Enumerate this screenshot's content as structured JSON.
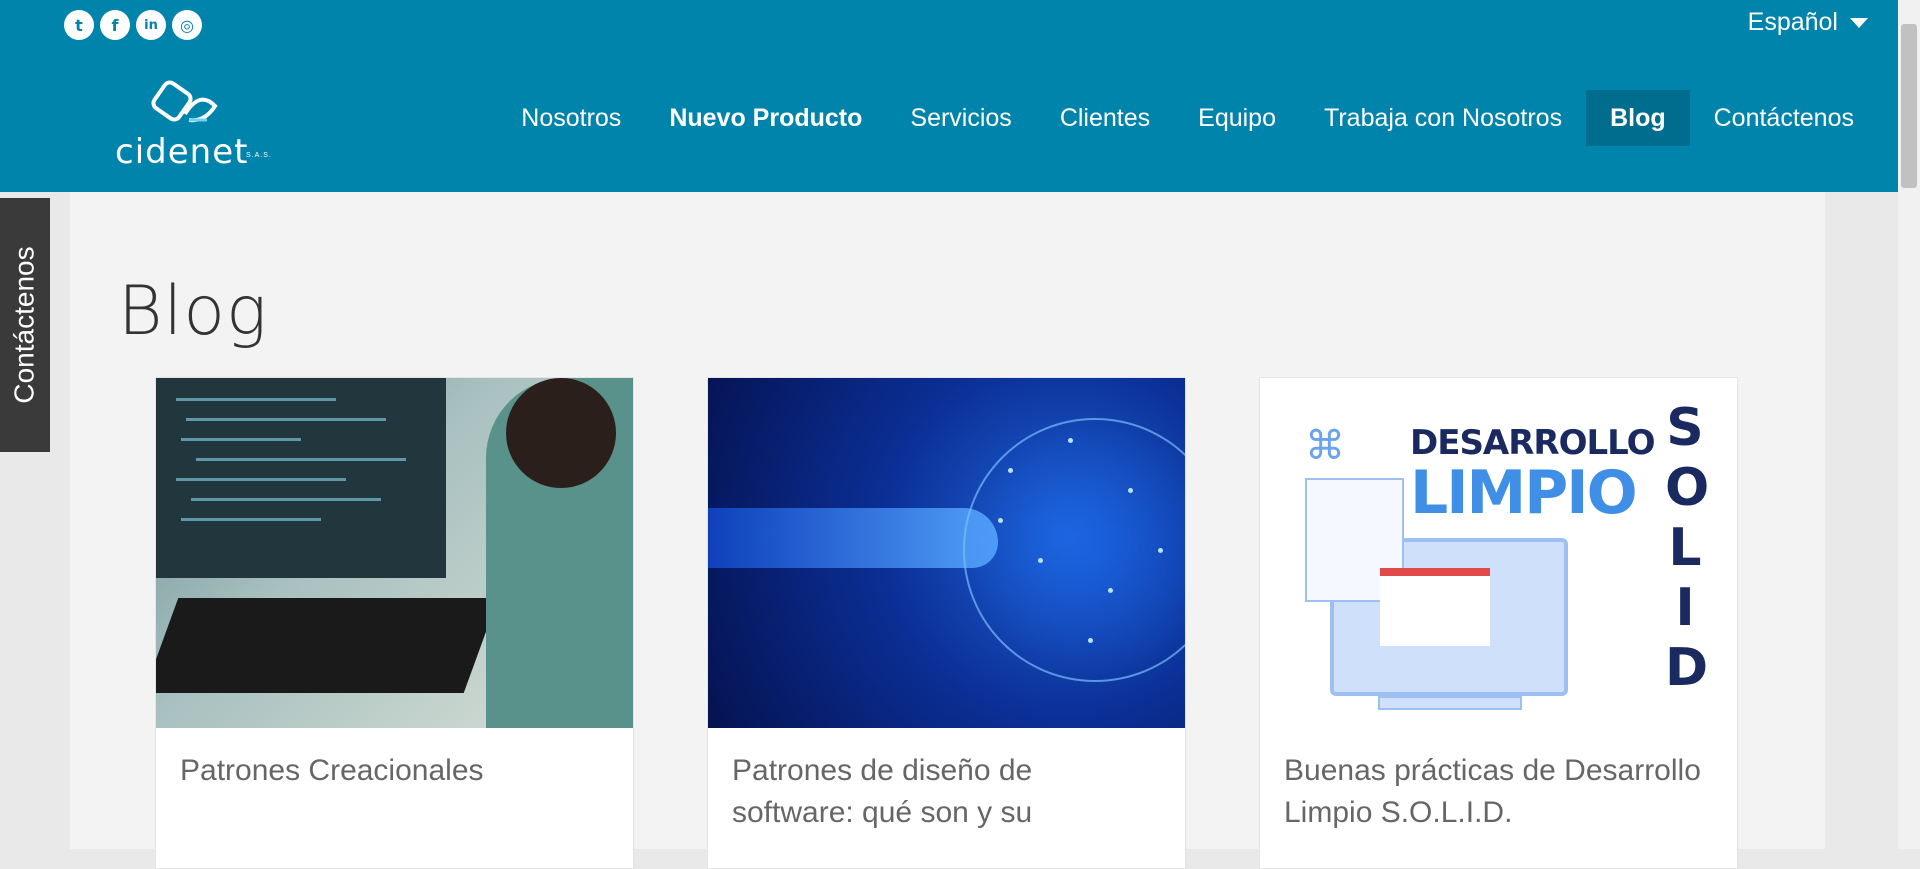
{
  "header": {
    "social": [
      {
        "name": "twitter-icon",
        "glyph": "t"
      },
      {
        "name": "facebook-icon",
        "glyph": "f"
      },
      {
        "name": "linkedin-icon",
        "glyph": "in"
      },
      {
        "name": "instagram-icon",
        "glyph": "◎"
      }
    ],
    "language": "Español",
    "logo": {
      "brand": "cidenet",
      "suffix": "S.A.S."
    },
    "nav": [
      {
        "label": "Nosotros"
      },
      {
        "label": "Nuevo Producto"
      },
      {
        "label": "Servicios"
      },
      {
        "label": "Clientes"
      },
      {
        "label": "Equipo"
      },
      {
        "label": "Trabaja con Nosotros"
      },
      {
        "label": "Blog"
      },
      {
        "label": "Contáctenos"
      }
    ]
  },
  "side_tab": {
    "label": "Contáctenos"
  },
  "main": {
    "title": "Blog",
    "posts": [
      {
        "title": "Patrones Creacionales"
      },
      {
        "title": "Patrones de diseño de software: qué son y su"
      },
      {
        "title": "Buenas prácticas de Desarrollo Limpio S.O.L.I.D."
      }
    ],
    "post3_image": {
      "line1": "DESARROLLO",
      "line2": "LIMPIO",
      "side": "SOLID"
    }
  },
  "colors": {
    "header": "#0084ab",
    "active_nav": "#006d8e",
    "side_tab": "#3a3a3a"
  }
}
